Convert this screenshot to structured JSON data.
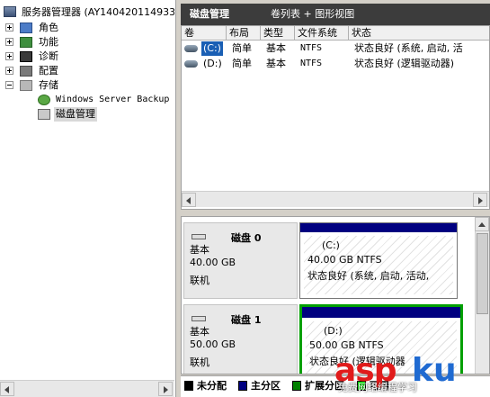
{
  "tree": {
    "root_label": "服务器管理器 (AY140420114933",
    "items": [
      {
        "label": "角色",
        "expanded": false
      },
      {
        "label": "功能",
        "expanded": false
      },
      {
        "label": "诊断",
        "expanded": false
      },
      {
        "label": "配置",
        "expanded": false
      },
      {
        "label": "存储",
        "expanded": true
      }
    ],
    "storage_children": [
      {
        "label": "Windows Server Backup"
      },
      {
        "label": "磁盘管理",
        "selected": true
      }
    ]
  },
  "header": {
    "title": "磁盘管理",
    "view": "卷列表 + 图形视图"
  },
  "volume_list": {
    "columns": [
      "卷",
      "布局",
      "类型",
      "文件系统",
      "状态"
    ],
    "rows": [
      {
        "name": "(C:)",
        "layout": "简单",
        "type": "基本",
        "fs": "NTFS",
        "status": "状态良好 (系统, 启动, 活"
      },
      {
        "name": "(D:)",
        "layout": "简单",
        "type": "基本",
        "fs": "NTFS",
        "status": "状态良好 (逻辑驱动器)"
      }
    ]
  },
  "disks": [
    {
      "title": "磁盘 0",
      "kind": "基本",
      "size": "40.00 GB",
      "state": "联机",
      "partition": {
        "name": "(C:)",
        "size_fs": "40.00 GB NTFS",
        "status": "状态良好 (系统, 启动, 活动,",
        "bar_color": "#000080"
      }
    },
    {
      "title": "磁盘 1",
      "kind": "基本",
      "size": "50.00 GB",
      "state": "联机",
      "partition": {
        "name": "(D:)",
        "size_fs": "50.00 GB NTFS",
        "status": "状态良好 (逻辑驱动器",
        "bar_color": "#000080",
        "outline_color": "#00a000"
      }
    }
  ],
  "legend": [
    {
      "label": "未分配",
      "color": "#000000"
    },
    {
      "label": "主分区",
      "color": "#000080"
    },
    {
      "label": "扩展分区",
      "color": "#008000"
    },
    {
      "label": "可用",
      "color": "#00ff00"
    }
  ],
  "watermark": {
    "asp": "asp",
    "ku": "ku",
    "sub": "免费网络编程学习"
  }
}
